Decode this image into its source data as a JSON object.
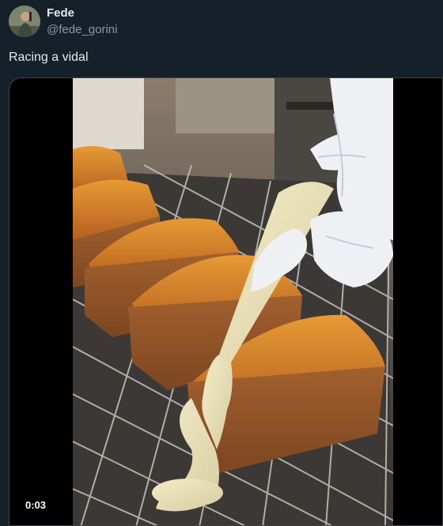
{
  "tweet": {
    "author_name": "Fede",
    "author_handle": "@fede_gorini",
    "text": "Racing a vidal"
  },
  "media": {
    "type": "video",
    "timestamp": "0:03"
  }
}
